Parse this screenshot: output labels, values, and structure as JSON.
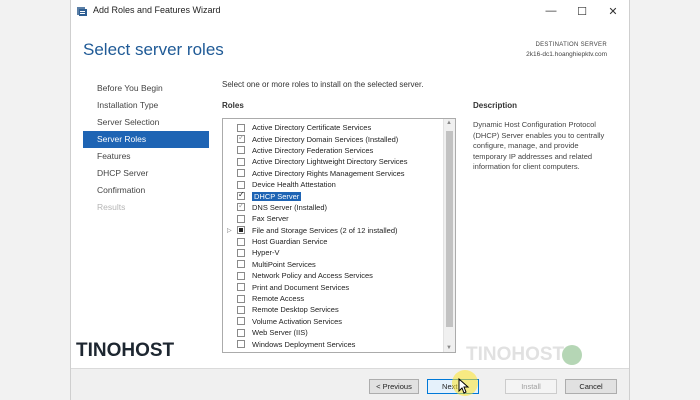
{
  "window": {
    "title": "Add Roles and Features Wizard",
    "controls": {
      "minimize": "—",
      "maximize": "☐",
      "close": "✕"
    }
  },
  "header": {
    "page_title": "Select server roles",
    "destination_label": "DESTINATION SERVER",
    "destination_value": "2k16-dc1.hoanghiepktv.com"
  },
  "nav": {
    "items": [
      {
        "label": "Before You Begin",
        "state": "normal"
      },
      {
        "label": "Installation Type",
        "state": "normal"
      },
      {
        "label": "Server Selection",
        "state": "normal"
      },
      {
        "label": "Server Roles",
        "state": "active"
      },
      {
        "label": "Features",
        "state": "normal"
      },
      {
        "label": "DHCP Server",
        "state": "normal"
      },
      {
        "label": "Confirmation",
        "state": "normal"
      },
      {
        "label": "Results",
        "state": "disabled"
      }
    ]
  },
  "main": {
    "instruction": "Select one or more roles to install on the selected server.",
    "roles_header": "Roles",
    "roles": [
      {
        "label": "Active Directory Certificate Services",
        "check": "none"
      },
      {
        "label": "Active Directory Domain Services (Installed)",
        "check": "checked-dim"
      },
      {
        "label": "Active Directory Federation Services",
        "check": "none"
      },
      {
        "label": "Active Directory Lightweight Directory Services",
        "check": "none"
      },
      {
        "label": "Active Directory Rights Management Services",
        "check": "none"
      },
      {
        "label": "Device Health Attestation",
        "check": "none"
      },
      {
        "label": "DHCP Server",
        "check": "checked",
        "selected": true
      },
      {
        "label": "DNS Server (Installed)",
        "check": "checked-dim"
      },
      {
        "label": "Fax Server",
        "check": "none"
      },
      {
        "label": "File and Storage Services (2 of 12 installed)",
        "check": "partial",
        "expandable": true
      },
      {
        "label": "Host Guardian Service",
        "check": "none"
      },
      {
        "label": "Hyper-V",
        "check": "none"
      },
      {
        "label": "MultiPoint Services",
        "check": "none"
      },
      {
        "label": "Network Policy and Access Services",
        "check": "none"
      },
      {
        "label": "Print and Document Services",
        "check": "none"
      },
      {
        "label": "Remote Access",
        "check": "none"
      },
      {
        "label": "Remote Desktop Services",
        "check": "none"
      },
      {
        "label": "Volume Activation Services",
        "check": "none"
      },
      {
        "label": "Web Server (IIS)",
        "check": "none"
      },
      {
        "label": "Windows Deployment Services",
        "check": "none"
      }
    ],
    "description_header": "Description",
    "description_text": "Dynamic Host Configuration Protocol (DHCP) Server enables you to centrally configure, manage, and provide temporary IP addresses and related information for client computers."
  },
  "footer": {
    "previous_label": "< Previous",
    "next_label": "Next >",
    "install_label": "Install",
    "cancel_label": "Cancel"
  },
  "watermark": {
    "left": "TINOHOST",
    "right": "TINOHOST"
  },
  "colors": {
    "accent": "#1e64b4",
    "title_blue": "#1f5a96",
    "cursor_halo": "#ffe628"
  }
}
